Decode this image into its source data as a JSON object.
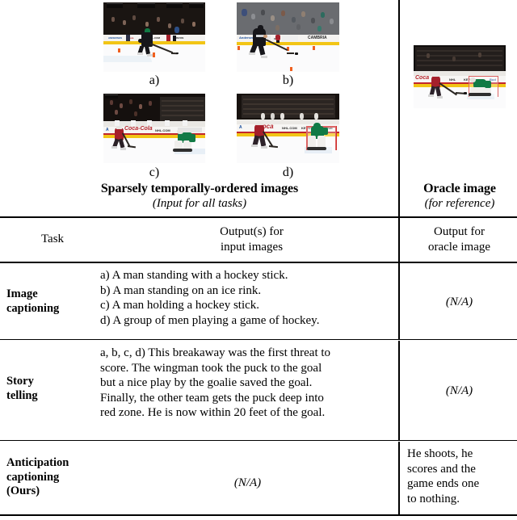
{
  "figure": {
    "image_panel": {
      "thumbnails": [
        {
          "id": "a",
          "label": "a)",
          "scene": "hockey-player-skating-with-puck-dark-jersey"
        },
        {
          "id": "b",
          "label": "b)",
          "scene": "hockey-player-carrying-puck-toward-goal"
        },
        {
          "id": "c",
          "label": "c)",
          "scene": "red-jersey-player-approaching-green-goalie"
        },
        {
          "id": "d",
          "label": "d)",
          "scene": "red-jersey-player-shooting-at-green-goalie-in-net"
        }
      ],
      "heading_bold": "Sparsely temporally-ordered images",
      "heading_italic": "(Input for all tasks)"
    },
    "oracle_panel": {
      "thumbnail": {
        "id": "oracle",
        "scene": "player-shooting-puck-past-goalie-into-net"
      },
      "heading_bold": "Oracle image",
      "heading_italic": "(for reference)"
    }
  },
  "table": {
    "headers": {
      "task": "Task",
      "input_outputs_line1": "Output(s) for",
      "input_outputs_line2": "input images",
      "oracle_output_line1": "Output for",
      "oracle_output_line2": "oracle image"
    },
    "rows": [
      {
        "task": "Image\ncaptioning",
        "task_line1": "Image",
        "task_line2": "captioning",
        "task_line3": "",
        "input_output_lines": [
          "a) A man standing with a hockey stick.",
          "b) A man standing on an ice rink.",
          "c) A man holding a hockey stick.",
          "d) A group of men playing a game of hockey."
        ],
        "oracle_output": "(N/A)",
        "oracle_output_is_na": true
      },
      {
        "task_line1": "Story",
        "task_line2": "telling",
        "task_line3": "",
        "input_output_lines": [
          "a, b, c, d) This breakaway was the first threat to",
          "score. The wingman took the puck to the goal",
          "but a nice play by the goalie saved the goal.",
          "Finally, the other team gets the puck deep into",
          "red zone. He is now within 20 feet of the goal."
        ],
        "oracle_output": "(N/A)",
        "oracle_output_is_na": true
      },
      {
        "task_line1": "Anticipation",
        "task_line2": "captioning",
        "task_line3": "(Ours)",
        "input_output_lines": [
          "(N/A)"
        ],
        "input_output_is_na": true,
        "oracle_output_lines": [
          "He shoots, he",
          "scores and the",
          "game ends one",
          "to nothing."
        ],
        "oracle_output_is_na": false
      }
    ]
  },
  "colors": {
    "rule": "#000000",
    "background": "#ffffff",
    "ice": "#fbfbfc",
    "board_yellow": "#f2c516",
    "board_red": "#c2262c",
    "jersey_dark": "#16161a",
    "jersey_red": "#a5202b",
    "jersey_green": "#117a45"
  }
}
